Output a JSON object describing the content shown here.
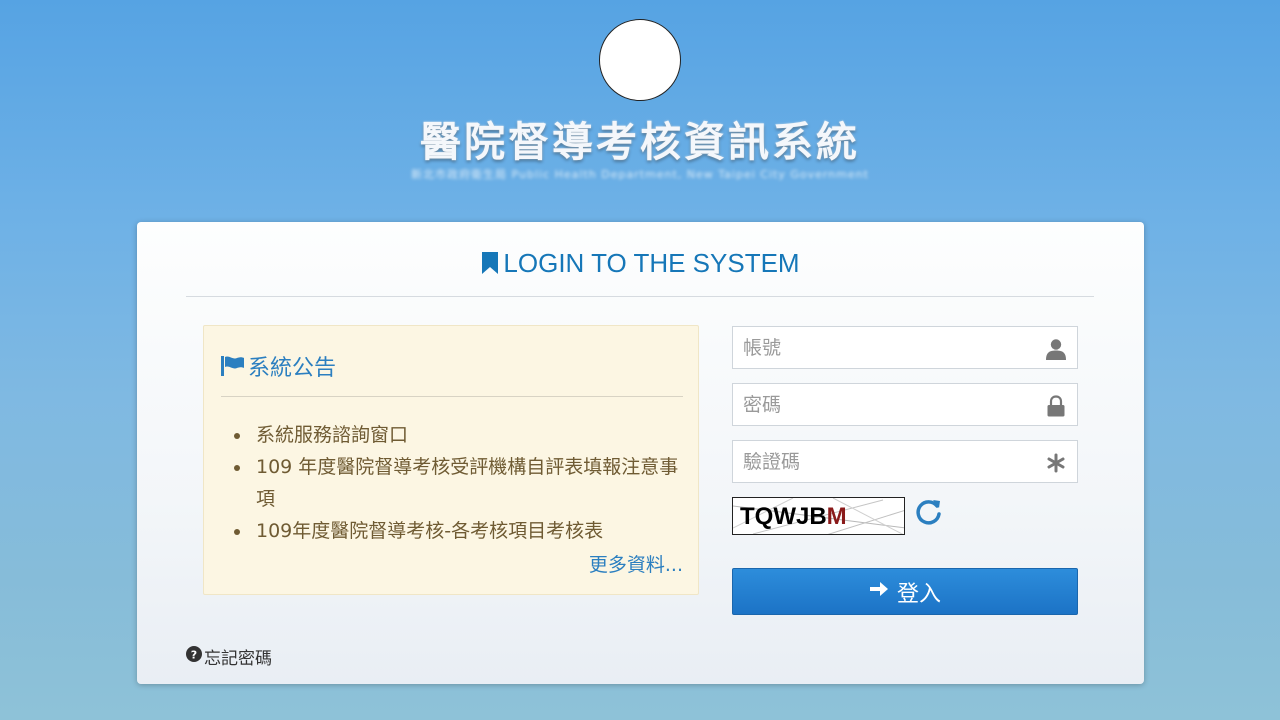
{
  "site": {
    "title": "醫院督導考核資訊系統",
    "subtitle": "新北市政府衛生局 Public Health Department, New Taipei City Government"
  },
  "panel": {
    "heading": "LOGIN TO THE SYSTEM"
  },
  "announcements": {
    "title": "系統公告",
    "items": [
      "系統服務諮詢窗口",
      "109 年度醫院督導考核受評機構自評表填報注意事項",
      "109年度醫院督導考核-各考核項目考核表"
    ],
    "more_link": "更多資料..."
  },
  "form": {
    "account_placeholder": "帳號",
    "password_placeholder": "密碼",
    "captcha_placeholder": "驗證碼",
    "captcha_text_main": "TQWJB",
    "captcha_text_tail": "M",
    "login_label": "登入",
    "forgot_label": "忘記密碼"
  },
  "icons": {
    "account": "user-icon",
    "password": "lock-icon",
    "captcha": "asterisk-icon",
    "refresh": "refresh-icon",
    "login": "arrow-right-icon",
    "forgot": "question-circle-icon",
    "heading": "bookmark-icon",
    "announcements": "flag-icon"
  },
  "colors": {
    "accent": "#1677b8",
    "button": "#1f7ccd",
    "notice_bg": "#fcf6e3",
    "notice_text": "#6f5b33"
  }
}
